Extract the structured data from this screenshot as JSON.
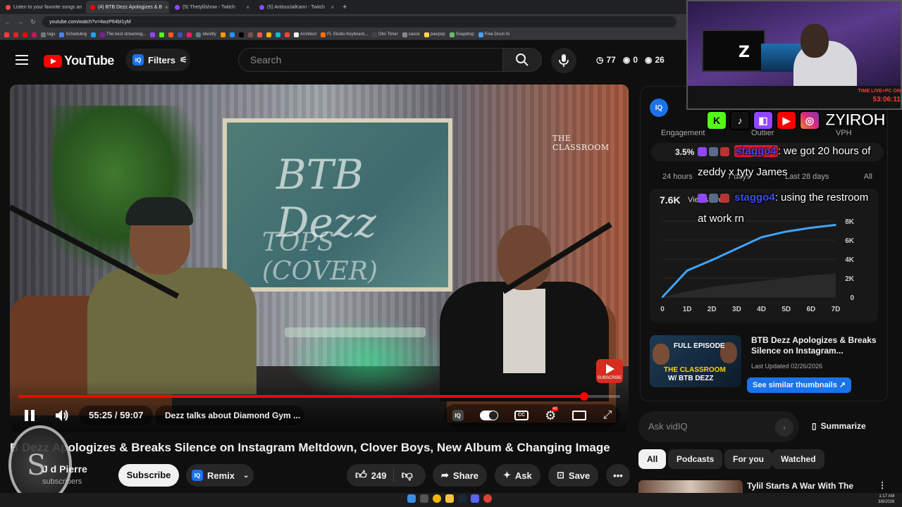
{
  "browser": {
    "tabs": [
      {
        "title": "Listen to your favorite songs an",
        "color": "#ff4b4b",
        "active": false
      },
      {
        "title": "(4) BTB Dezz Apologizes & B",
        "color": "#ff0000",
        "active": true
      },
      {
        "title": "(5) Thetylilshow - Twitch",
        "color": "#9146ff",
        "active": false
      },
      {
        "title": "(5) AntisocialKami - Twitch",
        "color": "#9146ff",
        "active": false
      }
    ],
    "url": "youtube.com/watch?v=4wzP64bI1yM",
    "bookmarks": [
      {
        "label": "",
        "color": "#ff3b3b"
      },
      {
        "label": "",
        "color": "#e02424"
      },
      {
        "label": "",
        "color": "#ff0000"
      },
      {
        "label": "",
        "color": "#c2185b"
      },
      {
        "label": "tags",
        "color": "#777"
      },
      {
        "label": "Scheduling",
        "color": "#4285f4"
      },
      {
        "label": "",
        "color": "#1da1f2"
      },
      {
        "label": "The best streaming...",
        "color": "#7b1fa2"
      },
      {
        "label": "",
        "color": "#9146ff"
      },
      {
        "label": "",
        "color": "#53fc18"
      },
      {
        "label": "",
        "color": "#ff5722"
      },
      {
        "label": "",
        "color": "#3f51b5"
      },
      {
        "label": "",
        "color": "#e91e63"
      },
      {
        "label": "Identify",
        "color": "#607d8b"
      },
      {
        "label": "",
        "color": "#ff9800"
      },
      {
        "label": "",
        "color": "#2196f3"
      },
      {
        "label": "",
        "color": "#000000"
      },
      {
        "label": "",
        "color": "#795548"
      },
      {
        "label": "",
        "color": "#ff5252"
      },
      {
        "label": "",
        "color": "#ffb300"
      },
      {
        "label": "",
        "color": "#00bcd4"
      },
      {
        "label": "",
        "color": "#f44336"
      },
      {
        "label": "Architect",
        "color": "#eeeeee"
      },
      {
        "label": "FL Studio Keyboard...",
        "color": "#ff6f00"
      },
      {
        "label": "Obs Timer",
        "color": "#444"
      },
      {
        "label": "sauce",
        "color": "#888"
      },
      {
        "label": "pawpop",
        "color": "#ffd54f"
      },
      {
        "label": "Snapdrop",
        "color": "#66bb6a"
      },
      {
        "label": "Free Drum Ki",
        "color": "#42a5f5"
      }
    ]
  },
  "header": {
    "logo_text": "YouTube",
    "filters_label": "Filters",
    "iq_label": "IQ",
    "search_placeholder": "Search",
    "stats": {
      "a": "77",
      "b": "0",
      "c": "26"
    }
  },
  "video_frame": {
    "board_line1": "BTB Dezz",
    "board_line2": "TOPS (COVER)",
    "brand": "THE CLASSROOM",
    "yt_badge": "SUBSCRIBE"
  },
  "player": {
    "time": "55:25 / 59:07",
    "chapter": "Dezz talks about Diamond Gym ...",
    "progress": 0.94,
    "hd_badge": "4K"
  },
  "video": {
    "title": "BTB Dezz Apologizes & Breaks Silence on Instagram Meltdown, Clover Boys, New Album & Changing Image",
    "title_visible": "B Dezz Apologizes & Breaks Silence on Instagram Meltdown, Clover Boys, New Album & Changing Image",
    "channel": "J    d   Pierre",
    "subscribers": "subscribers",
    "subscribe_label": "Subscribe",
    "remix_label": "Remix",
    "likes": "249",
    "share_label": "Share",
    "ask_label": "Ask",
    "save_label": "Save"
  },
  "vidiq": {
    "iq_label": "IQ",
    "labels": {
      "engagement": "Engagement",
      "outlier": "Outlier",
      "vph": "VPH"
    },
    "engagement_value": "3.5%",
    "ranges": [
      "24 hours",
      "7 days",
      "Last 28 days",
      "All"
    ],
    "views": "7.6K",
    "views_label": "Views over",
    "chart_yticks": [
      "8K",
      "6K",
      "4K",
      "2K",
      "0"
    ],
    "chart_xticks": [
      "0",
      "1D",
      "2D",
      "3D",
      "4D",
      "5D",
      "6D",
      "7D"
    ],
    "thumb": {
      "line1": "FULL EPISODE",
      "line2": "THE CLASSROOM",
      "line3": "W/ BTB DEZZ"
    },
    "card_title": "BTB Dezz Apologizes & Breaks Silence on Instagram...",
    "last_updated": "Last Updated 02/26/2026",
    "similar_label": "See similar thumbnails ↗",
    "ask_placeholder": "Ask vidIQ",
    "summarize_label": "Summarize"
  },
  "chips": [
    "All",
    "Podcasts",
    "For you",
    "Watched"
  ],
  "next_video": {
    "title": "Tylil Starts A War With The"
  },
  "chart_data": {
    "type": "line",
    "title": "",
    "xlabel": "",
    "ylabel": "",
    "categories": [
      "0",
      "1D",
      "2D",
      "3D",
      "4D",
      "5D",
      "6D",
      "7D"
    ],
    "ylim": [
      0,
      8000
    ],
    "series": [
      {
        "values": [
          0,
          2800,
          3900,
          5100,
          6300,
          6900,
          7300,
          7600
        ],
        "color": "#3ea6ff"
      },
      {
        "values": [
          0,
          600,
          1100,
          1400,
          1700,
          2000,
          2300,
          2500
        ],
        "color": "#2a2a2a"
      }
    ]
  },
  "stream_overlay": {
    "cam_logo": "Z",
    "timer_label": "TIME LIVE+PC ON",
    "timer": "53:06:11",
    "brand": "ZYIROH",
    "social_icons": [
      "kick-icon",
      "tiktok-icon",
      "twitch-icon",
      "youtube-icon",
      "instagram-icon"
    ],
    "chat": [
      {
        "user": "staggo4",
        "text": ": we got 20 hours of",
        "cont": "zeddy x tyty James"
      },
      {
        "user": "staggo4",
        "text": ": using the restroom",
        "cont": "at work rn"
      }
    ]
  },
  "taskbar": {
    "clock_time": "1:17 AM",
    "clock_date": "3/8/2026"
  }
}
